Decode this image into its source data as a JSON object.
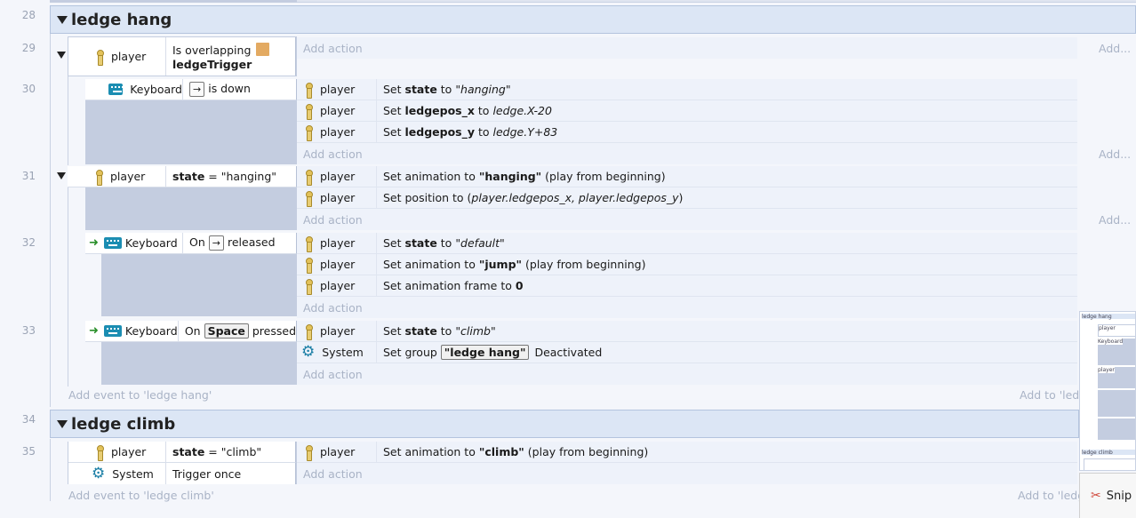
{
  "line_numbers": [
    "28",
    "29",
    "30",
    "31",
    "32",
    "33",
    "34",
    "35"
  ],
  "groups": [
    {
      "title": "ledge hang"
    },
    {
      "title": "ledge climb"
    }
  ],
  "common": {
    "add_action": "Add action",
    "add_action_right": "Add...",
    "add_event_hang": "Add event to 'ledge hang'",
    "add_event_climb": "Add event to 'ledge climb'",
    "add_to_hang": "Add to 'ledg",
    "add_to_climb": "Add to 'ledg"
  },
  "objects": {
    "player": "player",
    "keyboard": "Keyboard",
    "system": "System"
  },
  "e29": {
    "cond_line1": "Is overlapping",
    "cond_line2": "ledgeTrigger"
  },
  "e30": {
    "cond_key": "→",
    "cond_suffix": "is down",
    "a1_pre": "Set ",
    "a1_var": "state",
    "a1_mid": " to ",
    "a1_val": "\"hanging\"",
    "a2_pre": "Set ",
    "a2_var": "ledgepos_x",
    "a2_mid": " to ",
    "a2_val": "ledge.X-20",
    "a3_pre": "Set ",
    "a3_var": "ledgepos_y",
    "a3_mid": " to ",
    "a3_val": "ledge.Y+83"
  },
  "e31": {
    "cond_var": "state",
    "cond_rest": " = \"hanging\"",
    "a1_pre": "Set animation to ",
    "a1_val": "\"hanging\"",
    "a1_post": " (play from beginning)",
    "a2_pre": "Set position to (",
    "a2_val": "player.ledgepos_x, player.ledgepos_y",
    "a2_post": ")"
  },
  "e32": {
    "cond_pre": "On",
    "cond_key": "→",
    "cond_post": "released",
    "a1_pre": "Set ",
    "a1_var": "state",
    "a1_mid": " to ",
    "a1_val": "\"default\"",
    "a2_pre": "Set animation to ",
    "a2_val": "\"jump\"",
    "a2_post": " (play from beginning)",
    "a3_pre": "Set animation frame to ",
    "a3_val": "0"
  },
  "e33": {
    "cond_pre": "On",
    "cond_key": "Space",
    "cond_post": "pressed",
    "a1_pre": "Set ",
    "a1_var": "state",
    "a1_mid": " to ",
    "a1_val": "\"climb\"",
    "a2_pre": "Set group ",
    "a2_val": "\"ledge hang\"",
    "a2_post": " Deactivated"
  },
  "e35": {
    "c1_var": "state",
    "c1_rest": " = \"climb\"",
    "c2_text": "Trigger once",
    "a1_pre": "Set animation to ",
    "a1_val": "\"climb\"",
    "a1_post": " (play from beginning)"
  },
  "minimap": {
    "label_hang": "ledge hang",
    "label_climb": "ledge climb",
    "player": "player",
    "keyboard": "Keyboard"
  },
  "snip": {
    "label": "Snip"
  },
  "colors": {
    "group_header": "#dce6f5",
    "condition_panel": "#c4cde0",
    "action_bg": "#eef2fa",
    "key_border": "#777777",
    "keyboard_icon": "#1b8db2",
    "system_icon": "#1a7ea5",
    "object_icon": "#e3aa62"
  }
}
